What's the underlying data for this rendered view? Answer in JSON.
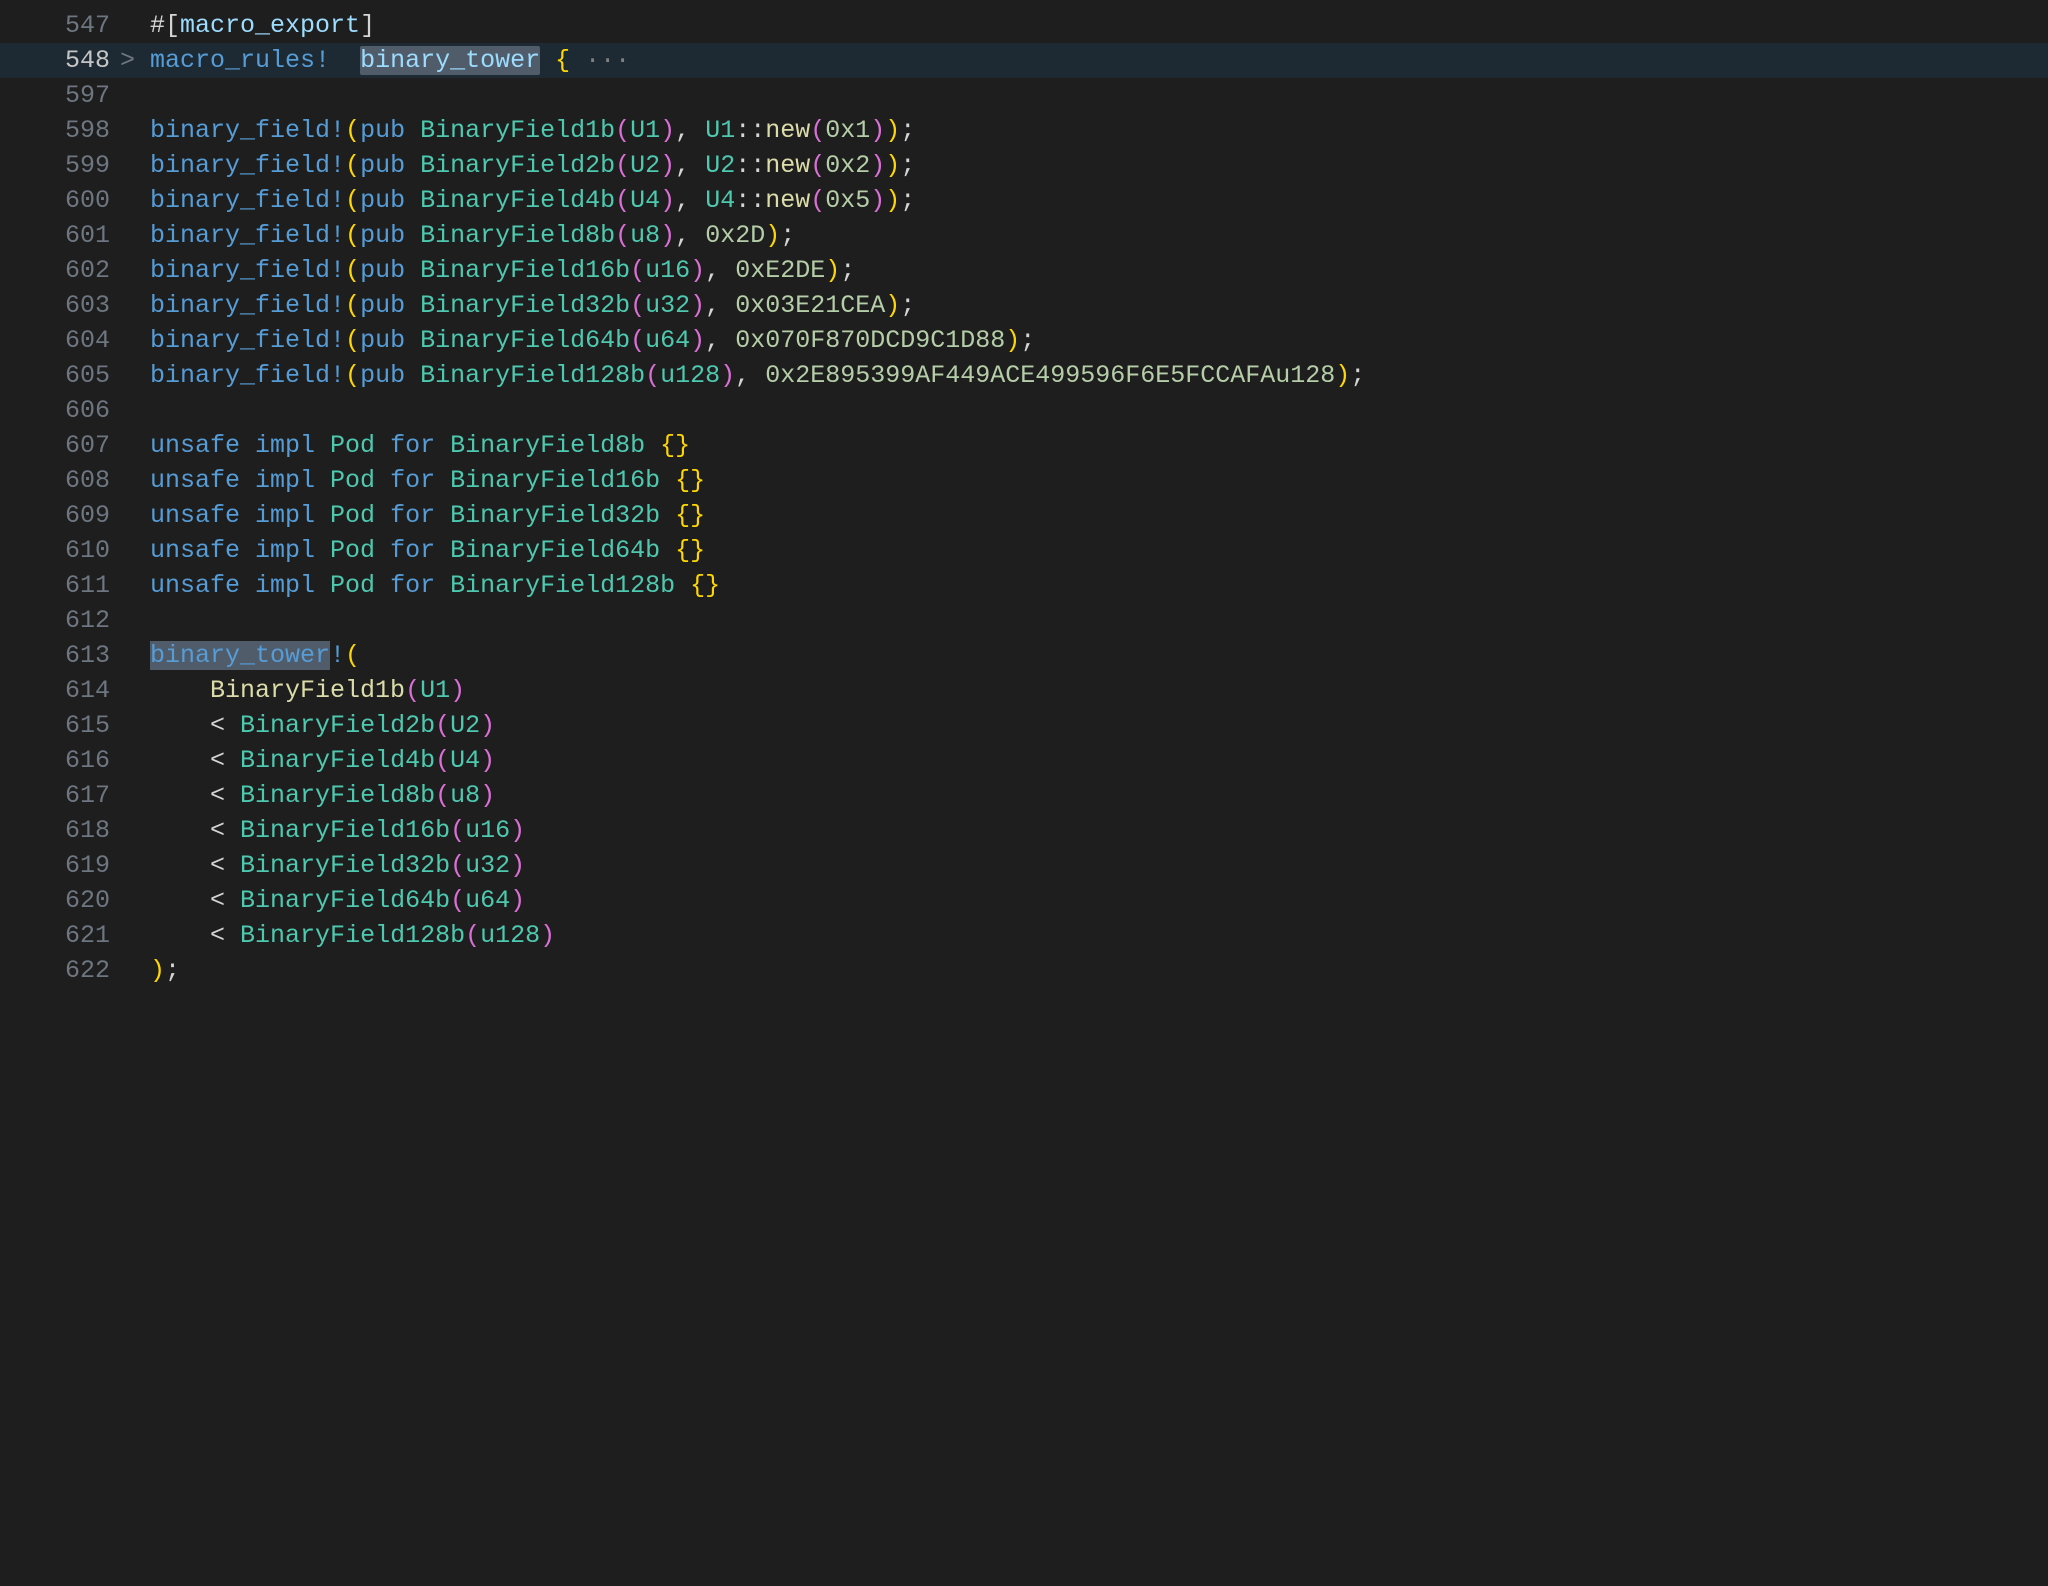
{
  "lines": {
    "l547": {
      "num": "547",
      "fold": "",
      "attr_hash": "#",
      "attr_open": "[",
      "attr_body": "macro_export",
      "attr_close": "]"
    },
    "l548": {
      "num": "548",
      "fold": ">",
      "kw_macro": "macro_rules",
      "bang": "!",
      "sp": "  ",
      "name": "binary_tower",
      "sp2": " ",
      "brace": "{",
      "dots": " ···"
    },
    "l597": {
      "num": "597",
      "fold": ""
    },
    "bf1": {
      "num": "598",
      "macro": "binary_field",
      "bang": "!",
      "po": "(",
      "pub": "pub ",
      "type": "BinaryField1b",
      "pi": "(",
      "inner": "U1",
      "pc": ")",
      "comma": ", ",
      "call": "U1",
      "cc": "::",
      "new": "new",
      "npo": "(",
      "arg": "0x1",
      "npc": ")",
      "pcend": ")",
      "semi": ";"
    },
    "bf2": {
      "num": "599",
      "macro": "binary_field",
      "bang": "!",
      "po": "(",
      "pub": "pub ",
      "type": "BinaryField2b",
      "pi": "(",
      "inner": "U2",
      "pc": ")",
      "comma": ", ",
      "call": "U2",
      "cc": "::",
      "new": "new",
      "npo": "(",
      "arg": "0x2",
      "npc": ")",
      "pcend": ")",
      "semi": ";"
    },
    "bf3": {
      "num": "600",
      "macro": "binary_field",
      "bang": "!",
      "po": "(",
      "pub": "pub ",
      "type": "BinaryField4b",
      "pi": "(",
      "inner": "U4",
      "pc": ")",
      "comma": ", ",
      "call": "U4",
      "cc": "::",
      "new": "new",
      "npo": "(",
      "arg": "0x5",
      "npc": ")",
      "pcend": ")",
      "semi": ";"
    },
    "bf4": {
      "num": "601",
      "macro": "binary_field",
      "bang": "!",
      "po": "(",
      "pub": "pub ",
      "type": "BinaryField8b",
      "pi": "(",
      "inner": "u8",
      "pc": ")",
      "comma": ", ",
      "arg": "0x2D",
      "pcend": ")",
      "semi": ";"
    },
    "bf5": {
      "num": "602",
      "macro": "binary_field",
      "bang": "!",
      "po": "(",
      "pub": "pub ",
      "type": "BinaryField16b",
      "pi": "(",
      "inner": "u16",
      "pc": ")",
      "comma": ", ",
      "arg": "0xE2DE",
      "pcend": ")",
      "semi": ";"
    },
    "bf6": {
      "num": "603",
      "macro": "binary_field",
      "bang": "!",
      "po": "(",
      "pub": "pub ",
      "type": "BinaryField32b",
      "pi": "(",
      "inner": "u32",
      "pc": ")",
      "comma": ", ",
      "arg": "0x03E21CEA",
      "pcend": ")",
      "semi": ";"
    },
    "bf7": {
      "num": "604",
      "macro": "binary_field",
      "bang": "!",
      "po": "(",
      "pub": "pub ",
      "type": "BinaryField64b",
      "pi": "(",
      "inner": "u64",
      "pc": ")",
      "comma": ", ",
      "arg": "0x070F870DCD9C1D88",
      "pcend": ")",
      "semi": ";"
    },
    "bf8": {
      "num": "605",
      "macro": "binary_field",
      "bang": "!",
      "po": "(",
      "pub": "pub ",
      "type": "BinaryField128b",
      "pi": "(",
      "inner": "u128",
      "pc": ")",
      "comma": ", ",
      "arg": "0x2E895399AF449ACE499596F6E5FCCAFAu128",
      "pcend": ")",
      "semi": ";"
    },
    "l606": {
      "num": "606"
    },
    "im1": {
      "num": "607",
      "unsafe": "unsafe ",
      "impl": "impl ",
      "trait": "Pod",
      "for": " for ",
      "type": "BinaryField8b",
      "sp": " ",
      "bo": "{",
      "bc": "}"
    },
    "im2": {
      "num": "608",
      "unsafe": "unsafe ",
      "impl": "impl ",
      "trait": "Pod",
      "for": " for ",
      "type": "BinaryField16b",
      "sp": " ",
      "bo": "{",
      "bc": "}"
    },
    "im3": {
      "num": "609",
      "unsafe": "unsafe ",
      "impl": "impl ",
      "trait": "Pod",
      "for": " for ",
      "type": "BinaryField32b",
      "sp": " ",
      "bo": "{",
      "bc": "}"
    },
    "im4": {
      "num": "610",
      "unsafe": "unsafe ",
      "impl": "impl ",
      "trait": "Pod",
      "for": " for ",
      "type": "BinaryField64b",
      "sp": " ",
      "bo": "{",
      "bc": "}"
    },
    "im5": {
      "num": "611",
      "unsafe": "unsafe ",
      "impl": "impl ",
      "trait": "Pod",
      "for": " for ",
      "type": "BinaryField128b",
      "sp": " ",
      "bo": "{",
      "bc": "}"
    },
    "l612": {
      "num": "612"
    },
    "bt_open": {
      "num": "613",
      "macro": "binary_tower",
      "bang": "!",
      "po": "("
    },
    "bt1": {
      "num": "614",
      "indent": "    ",
      "type": "BinaryField1b",
      "po": "(",
      "inner": "U1",
      "pc": ")"
    },
    "bt2": {
      "num": "615",
      "indent": "    ",
      "lt": "<",
      "type": "BinaryField2b",
      "po": "(",
      "inner": "U2",
      "pc": ")"
    },
    "bt3": {
      "num": "616",
      "indent": "    ",
      "lt": "<",
      "type": "BinaryField4b",
      "po": "(",
      "inner": "U4",
      "pc": ")"
    },
    "bt4": {
      "num": "617",
      "indent": "    ",
      "lt": "<",
      "type": "BinaryField8b",
      "po": "(",
      "inner": "u8",
      "pc": ")"
    },
    "bt5": {
      "num": "618",
      "indent": "    ",
      "lt": "<",
      "type": "BinaryField16b",
      "po": "(",
      "inner": "u16",
      "pc": ")"
    },
    "bt6": {
      "num": "619",
      "indent": "    ",
      "lt": "<",
      "type": "BinaryField32b",
      "po": "(",
      "inner": "u32",
      "pc": ")"
    },
    "bt7": {
      "num": "620",
      "indent": "    ",
      "lt": "<",
      "type": "BinaryField64b",
      "po": "(",
      "inner": "u64",
      "pc": ")"
    },
    "bt8": {
      "num": "621",
      "indent": "    ",
      "lt": "<",
      "type": "BinaryField128b",
      "po": "(",
      "inner": "u128",
      "pc": ")"
    },
    "bt_close": {
      "num": "622",
      "pc": ")",
      "semi": ";"
    }
  }
}
